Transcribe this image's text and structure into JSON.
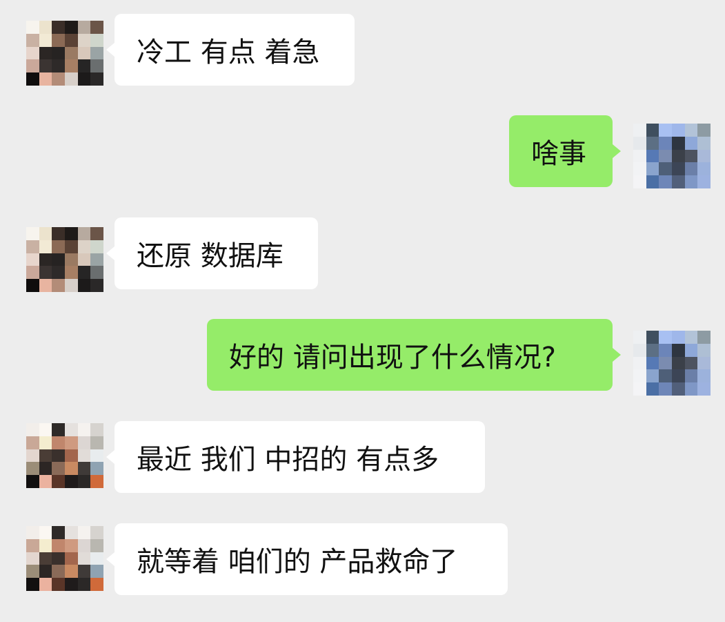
{
  "chat": {
    "messages": [
      {
        "side": "left",
        "text": "冷工 有点 着急"
      },
      {
        "side": "right",
        "text": "啥事"
      },
      {
        "side": "left",
        "text": "还原 数据库"
      },
      {
        "side": "right",
        "text": "好的 请问出现了什么情况?"
      },
      {
        "side": "left",
        "text": "最近 我们 中招的 有点多"
      },
      {
        "side": "left",
        "text": "就等着 咱们的 产品救命了"
      }
    ]
  },
  "colors": {
    "background": "#ededed",
    "incoming_bubble": "#ffffff",
    "outgoing_bubble": "#95ec69",
    "text": "#111111"
  },
  "icons": {
    "incoming_avatar": "pixelated-avatar-icon",
    "outgoing_avatar": "pixelated-avatar-icon"
  }
}
